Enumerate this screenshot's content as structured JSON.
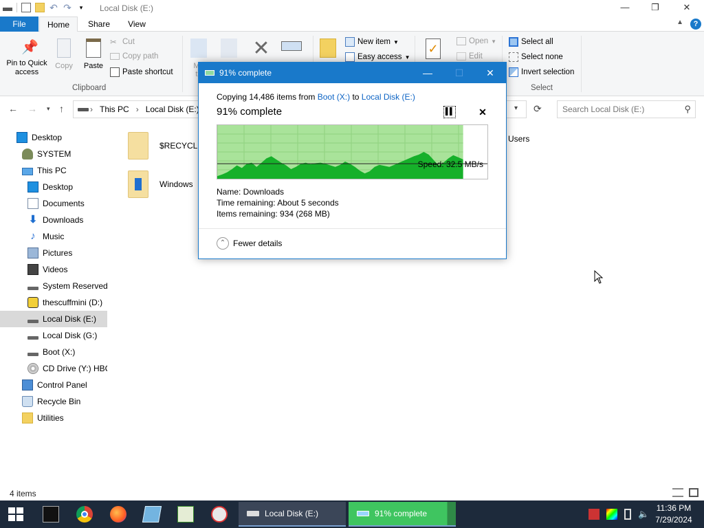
{
  "window": {
    "title": "Local Disk (E:)"
  },
  "ribbon_tabs": [
    "File",
    "Home",
    "Share",
    "View"
  ],
  "ribbon": {
    "pin_label": "Pin to Quick access",
    "copy_label": "Copy",
    "paste_label": "Paste",
    "cut_label": "Cut",
    "copy_path_label": "Copy path",
    "paste_shortcut_label": "Paste shortcut",
    "clipboard_group": "Clipboard",
    "move_label_partial": "Mo",
    "move_label_partial2": "to",
    "new_item_label": "New item",
    "easy_access_label": "Easy access",
    "open_label": "Open",
    "edit_label": "Edit",
    "select_all_label": "Select all",
    "select_none_label": "Select none",
    "invert_selection_label": "Invert selection",
    "select_group": "Select"
  },
  "address": {
    "crumbs": [
      "This PC",
      "Local Disk (E:)"
    ],
    "search_placeholder": "Search Local Disk (E:)"
  },
  "nav_pane": [
    {
      "label": "Desktop",
      "icon": "desktop-icon"
    },
    {
      "label": "SYSTEM",
      "icon": "user-icon"
    },
    {
      "label": "This PC",
      "icon": "computer-icon"
    },
    {
      "label": "Desktop",
      "icon": "desktop-icon"
    },
    {
      "label": "Documents",
      "icon": "documents-icon"
    },
    {
      "label": "Downloads",
      "icon": "downloads-icon"
    },
    {
      "label": "Music",
      "icon": "music-icon"
    },
    {
      "label": "Pictures",
      "icon": "pictures-icon"
    },
    {
      "label": "Videos",
      "icon": "videos-icon"
    },
    {
      "label": "System Reserved (",
      "icon": "drive-icon"
    },
    {
      "label": "thescuffmini (D:)",
      "icon": "usb-drive-icon"
    },
    {
      "label": "Local Disk (E:)",
      "icon": "drive-icon"
    },
    {
      "label": "Local Disk (G:)",
      "icon": "drive-icon"
    },
    {
      "label": "Boot (X:)",
      "icon": "drive-icon"
    },
    {
      "label": "CD Drive (Y:) HBC",
      "icon": "cd-drive-icon"
    },
    {
      "label": "Control Panel",
      "icon": "control-panel-icon"
    },
    {
      "label": "Recycle Bin",
      "icon": "recycle-bin-icon"
    },
    {
      "label": "Utilities",
      "icon": "folder-icon"
    }
  ],
  "files": [
    {
      "name": "$RECYCLE."
    },
    {
      "name": "Windows"
    },
    {
      "name": "Users"
    }
  ],
  "status": {
    "item_count": "4 items"
  },
  "copy_dialog": {
    "title": "91% complete",
    "copying_prefix": "Copying 14,486 items from ",
    "source": "Boot (X:)",
    "to_word": " to ",
    "destination": "Local Disk (E:)",
    "percent_label": "91% complete",
    "progress": 0.91,
    "speed": "Speed: 32.5 MB/s",
    "name_line": "Name:  Downloads",
    "time_line": "Time remaining:  About 5 seconds",
    "items_line": "Items remaining:  934 (268 MB)",
    "fewer_details": "Fewer details",
    "throughput_profile": [
      0.05,
      0.08,
      0.12,
      0.18,
      0.25,
      0.2,
      0.28,
      0.3,
      0.22,
      0.3,
      0.38,
      0.42,
      0.36,
      0.3,
      0.25,
      0.18,
      0.22,
      0.28,
      0.3,
      0.27,
      0.29,
      0.3,
      0.28,
      0.25,
      0.22,
      0.26,
      0.32,
      0.28,
      0.22,
      0.15,
      0.1,
      0.14,
      0.22,
      0.26,
      0.24,
      0.22,
      0.26,
      0.3,
      0.34,
      0.38,
      0.42,
      0.45,
      0.5,
      0.45,
      0.35,
      0.25,
      0.3,
      0.38,
      0.44,
      0.4,
      0.36
    ],
    "speed_level": 0.28
  },
  "taskbar": {
    "tasks": [
      "Local Disk (E:)",
      "91% complete"
    ],
    "time": "11:36 PM",
    "date": "7/29/2024"
  },
  "colors": {
    "accent": "#1979ca",
    "progress_fill": "#a9e39a",
    "graph_fill": "#16b02a"
  }
}
